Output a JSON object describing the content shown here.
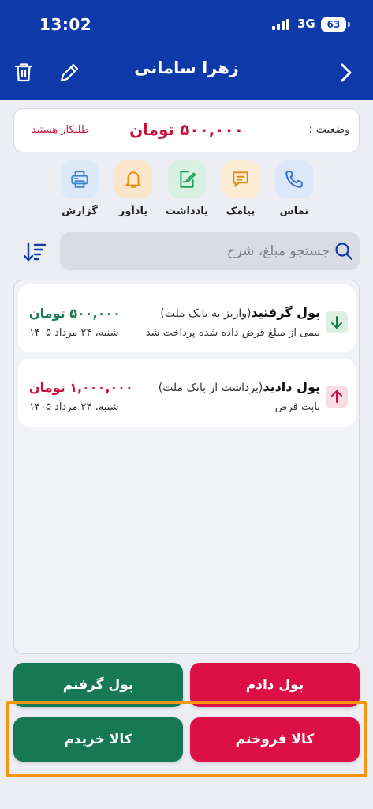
{
  "status_bar": {
    "time": "13:02",
    "network": "3G",
    "battery": "63"
  },
  "header": {
    "title": "زهرا سامانی"
  },
  "status": {
    "label": "وضعیت :",
    "amount": "۵۰۰,۰۰۰ تومان",
    "note": "طلبکار هستید"
  },
  "actions": [
    {
      "label": "تماس",
      "icon": "phone-icon",
      "color": "#2f6fd6",
      "bg": "#dce8f9"
    },
    {
      "label": "پیامک",
      "icon": "message-icon",
      "color": "#e08a12",
      "bg": "#fbecd3"
    },
    {
      "label": "یادداشت",
      "icon": "note-icon",
      "color": "#22a35a",
      "bg": "#d8f0e1"
    },
    {
      "label": "یادآور",
      "icon": "bell-icon",
      "color": "#e8900f",
      "bg": "#fbe6cc"
    },
    {
      "label": "گزارش",
      "icon": "printer-icon",
      "color": "#3a86d8",
      "bg": "#dbe9f8"
    }
  ],
  "search": {
    "placeholder": "جستجو مبلغ، شرح"
  },
  "transactions": [
    {
      "title": "پول گرفتید",
      "subtitle": "(واریز به بانک ملت)",
      "description": "نیمی از مبلغ قرض داده شده پرداخت شد",
      "amount": "۵۰۰,۰۰۰ تومان",
      "date": "شنبه، ۲۴ مرداد ۱۴۰۵",
      "direction": "down",
      "color": "#1c7a52"
    },
    {
      "title": "پول دادید",
      "subtitle": "(برداشت از بانک ملت)",
      "description": "بابت قرض",
      "amount": "۱,۰۰۰,۰۰۰ تومان",
      "date": "شنبه، ۲۴ مرداد ۱۴۰۵",
      "direction": "up",
      "color": "#c8103c"
    }
  ],
  "buttons": {
    "gave_money": "پول دادم",
    "got_money": "پول گرفتم",
    "sold_goods": "کالا فروختم",
    "bought_goods": "کالا خریدم"
  },
  "colors": {
    "header": "#0e3aa9",
    "red": "#dc0f47",
    "green": "#177856",
    "highlight": "#f7950d"
  }
}
